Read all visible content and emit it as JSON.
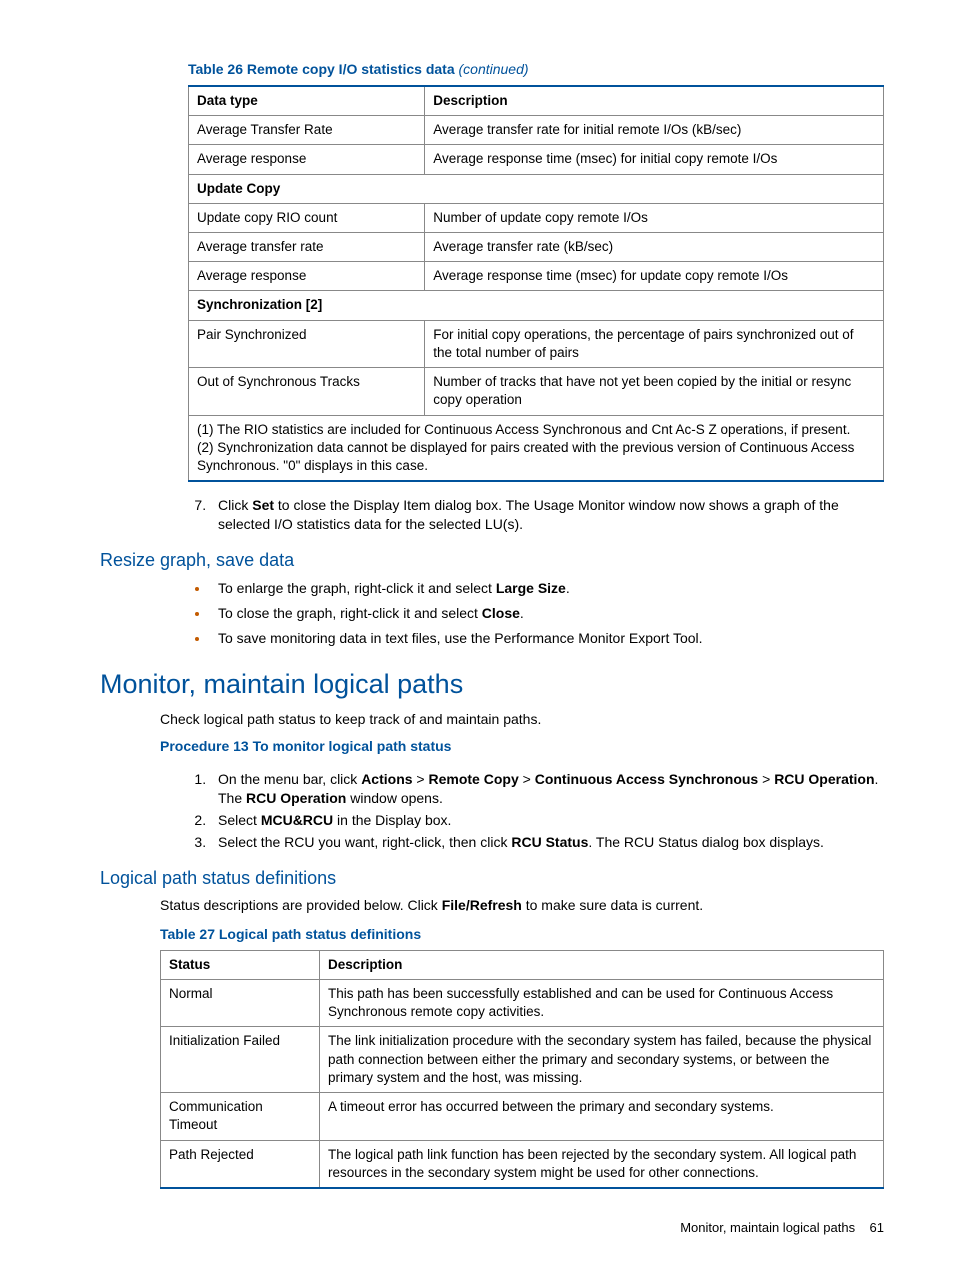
{
  "table26": {
    "title": "Table 26 Remote copy I/O statistics data",
    "continued": "(continued)",
    "headers": [
      "Data type",
      "Description"
    ],
    "rows": [
      {
        "c1": "Average Transfer Rate",
        "c2": "Average transfer rate for initial remote I/Os (kB/sec)"
      },
      {
        "c1": "Average response",
        "c2": "Average response time (msec) for initial copy remote I/Os"
      }
    ],
    "section1": "Update Copy",
    "rows2": [
      {
        "c1": "Update copy RIO count",
        "c2": "Number of update copy remote I/Os"
      },
      {
        "c1": "Average transfer rate",
        "c2": "Average transfer rate (kB/sec)"
      },
      {
        "c1": "Average response",
        "c2": "Average response time (msec) for update copy remote I/Os"
      }
    ],
    "section2": "Synchronization [2]",
    "rows3": [
      {
        "c1": "Pair Synchronized",
        "c2": "For initial copy operations, the percentage of pairs synchronized out of the total number of pairs"
      },
      {
        "c1": "Out of Synchronous Tracks",
        "c2": "Number of tracks that have not yet been copied by the initial or resync copy operation"
      }
    ],
    "footnote1": "(1) The RIO statistics are included for Continuous Access Synchronous and Cnt Ac-S Z operations, if present.",
    "footnote2": "(2) Synchronization data cannot be displayed for pairs created with the previous version of Continuous Access Synchronous. \"0\" displays in this case."
  },
  "step7": {
    "num": "7.",
    "pre": "Click ",
    "bold": "Set",
    "post": " to close the Display Item dialog box. The Usage Monitor window now shows a graph of the selected I/O statistics data for the selected LU(s)."
  },
  "resize": {
    "title": "Resize graph, save data",
    "b1": {
      "pre": "To enlarge the graph, right-click it and select ",
      "bold": "Large Size",
      "post": "."
    },
    "b2": {
      "pre": "To close the graph, right-click it and select ",
      "bold": "Close",
      "post": "."
    },
    "b3": "To save monitoring data in text files, use the Performance Monitor Export Tool."
  },
  "monitor": {
    "title": "Monitor, maintain logical paths",
    "intro": "Check logical path status to keep track of and maintain paths.",
    "proc_title": "Procedure 13 To monitor logical path status",
    "s1": {
      "a": "On the menu bar, click ",
      "b1": "Actions",
      "g1": " > ",
      "b2": "Remote Copy",
      "g2": " > ",
      "b3": "Continuous Access Synchronous",
      "g3": " > ",
      "b4": "RCU Operation",
      "mid": ". The ",
      "b5": "RCU Operation",
      "end": " window opens."
    },
    "s2": {
      "a": "Select ",
      "b": "MCU&RCU",
      "c": " in the Display box."
    },
    "s3": {
      "a": "Select the RCU you want, right-click, then click ",
      "b": "RCU Status",
      "c": ". The RCU Status dialog box displays."
    }
  },
  "logical": {
    "title": "Logical path status definitions",
    "intro_a": "Status descriptions are provided below. Click ",
    "intro_b": "File/Refresh",
    "intro_c": " to make sure data is current.",
    "table_title": "Table 27 Logical path status definitions",
    "headers": [
      "Status",
      "Description"
    ],
    "rows": [
      {
        "c1": "Normal",
        "c2": "This path has been successfully established and can be used for Continuous Access Synchronous remote copy activities."
      },
      {
        "c1": "Initialization Failed",
        "c2": "The link initialization procedure with the secondary system has failed, because the physical path connection between either the primary and secondary systems, or between the primary system and the host, was missing."
      },
      {
        "c1": "Communication Timeout",
        "c2": "A timeout error has occurred between the primary and secondary systems."
      },
      {
        "c1": "Path Rejected",
        "c2": "The logical path link function has been rejected by the secondary system. All logical path resources in the secondary system might be used for other connections."
      }
    ]
  },
  "footer": {
    "text": "Monitor, maintain logical paths",
    "page": "61"
  }
}
